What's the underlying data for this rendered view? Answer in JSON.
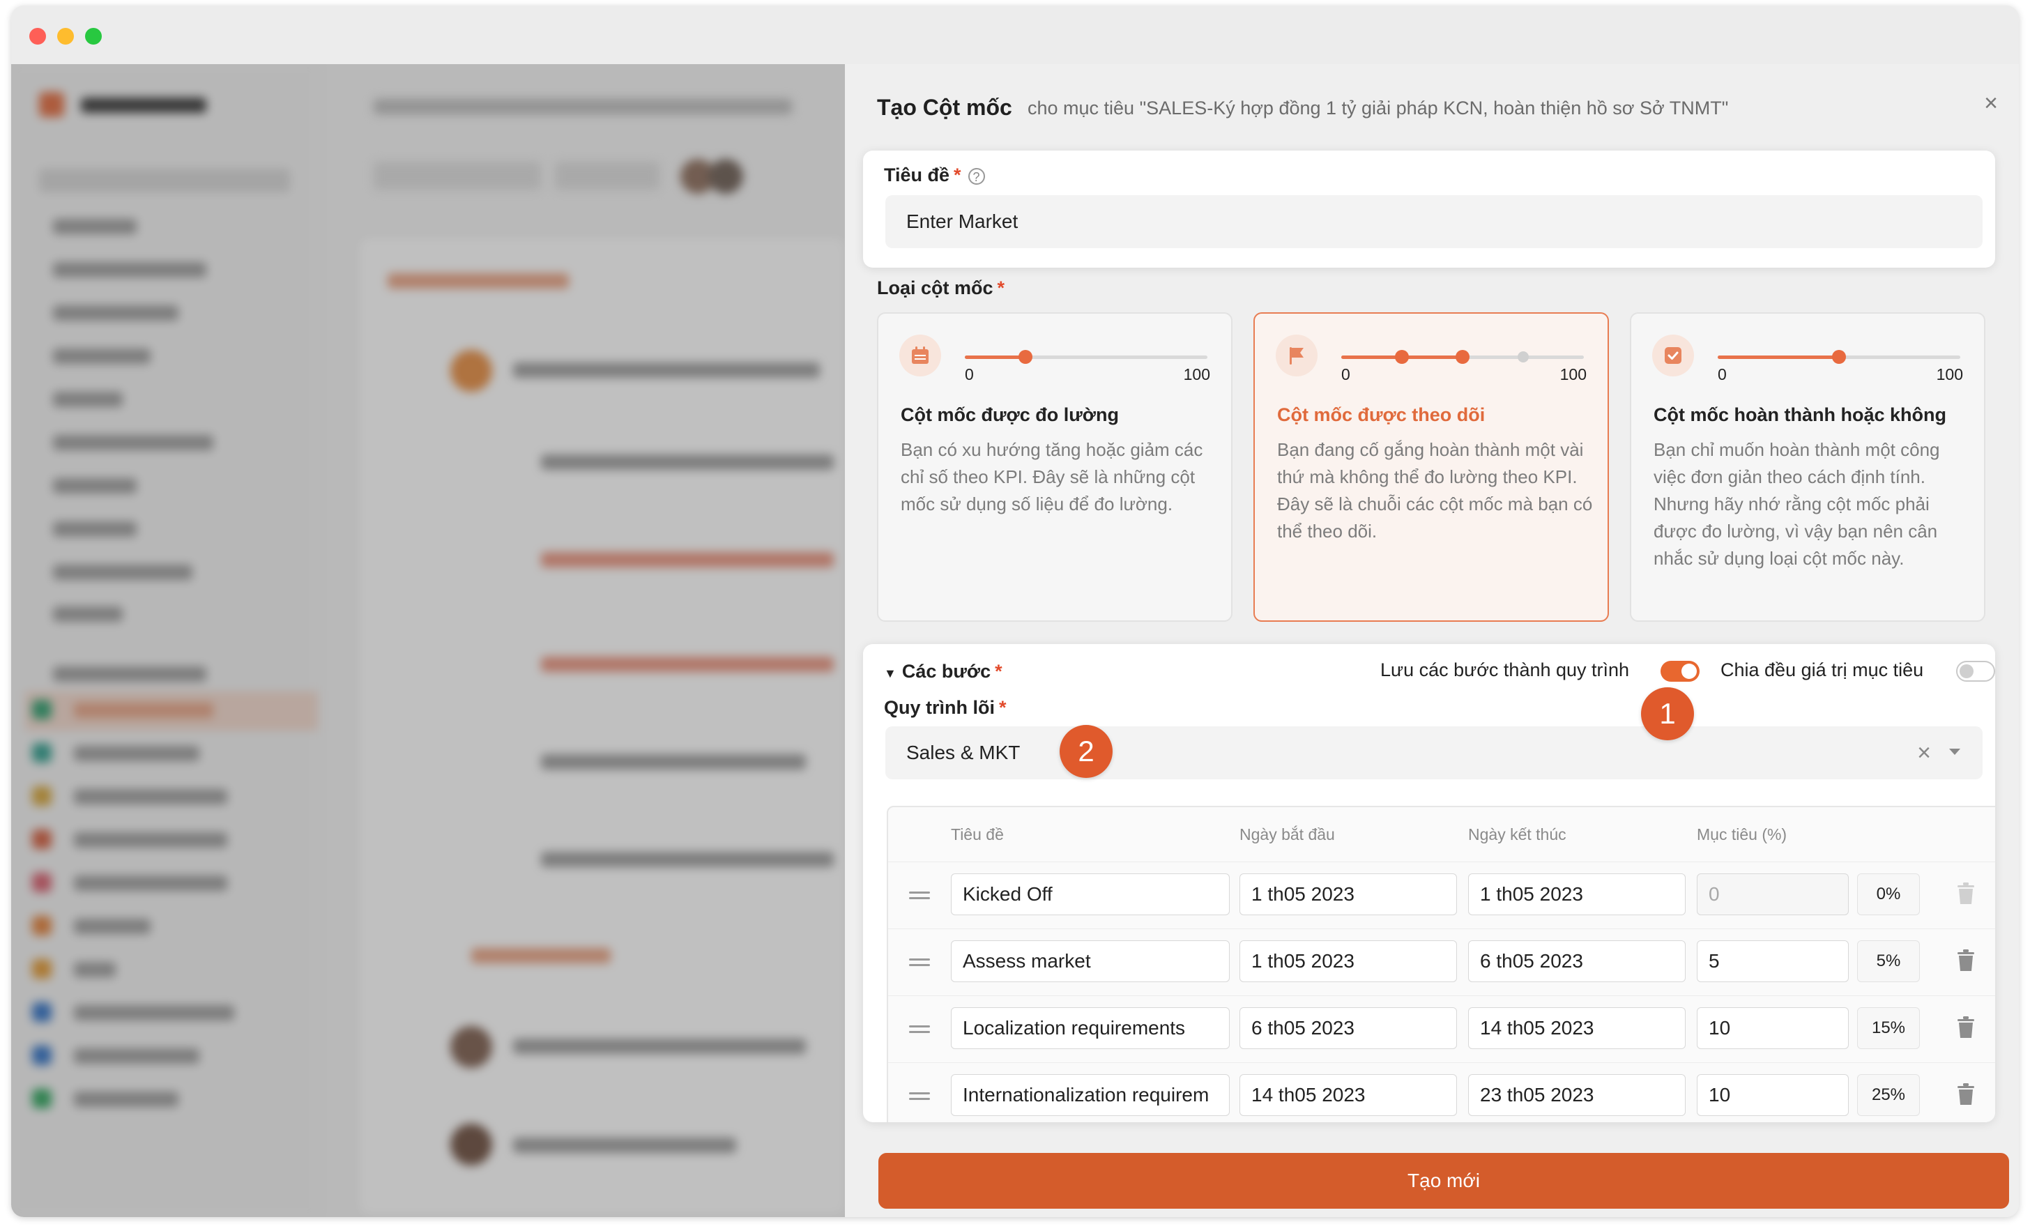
{
  "drawer": {
    "title": "Tạo Cột mốc",
    "subtitle": "cho mục tiêu \"SALES-Ký hợp đồng 1 tỷ giải pháp KCN, hoàn thiện hồ sơ Sở TNMT\"",
    "close_glyph": "×"
  },
  "title_field": {
    "label": "Tiêu đề",
    "required": "*",
    "help_glyph": "?",
    "value": "Enter Market"
  },
  "milestone_type": {
    "label": "Loại cột mốc",
    "required": "*",
    "options": [
      {
        "name": "Cột mốc được đo lường",
        "description": "Bạn có xu hướng tăng hoặc giảm các chỉ số theo KPI. Đây sẽ là những cột mốc sử dụng số liệu để đo lường.",
        "min": "0",
        "max": "100",
        "selected": false,
        "icon": "calendar-icon",
        "slider_value_pct": 25
      },
      {
        "name": "Cột mốc được theo dõi",
        "description": "Bạn đang cố gắng hoàn thành một vài thứ mà không thể đo lường theo KPI. Đây sẽ là chuỗi các cột mốc mà bạn có thể theo dõi.",
        "min": "0",
        "max": "100",
        "selected": true,
        "icon": "flag-icon",
        "slider_points_pct": [
          25,
          50,
          75
        ]
      },
      {
        "name": "Cột mốc hoàn thành hoặc không",
        "description": "Bạn chỉ muốn hoàn thành một công việc đơn giản theo cách định tính. Nhưng hãy nhớ rằng cột mốc phải được đo lường, vì vậy bạn nên cân nhắc sử dụng loại cột mốc này.",
        "min": "0",
        "max": "100",
        "selected": false,
        "icon": "checkbox-icon",
        "slider_value_pct": 50
      }
    ]
  },
  "steps": {
    "label": "Các bước",
    "required": "*",
    "save_as_process_label": "Lưu các bước thành quy trình",
    "save_as_process_on": true,
    "split_target_label": "Chia đều giá trị mục tiêu",
    "split_target_on": false,
    "core_process_label": "Quy trình lõi",
    "core_process_value": "Sales & MKT",
    "clear_glyph": "×",
    "columns": [
      "Tiêu đề",
      "Ngày bắt đầu",
      "Ngày kết thúc",
      "Mục tiêu (%)"
    ],
    "rows": [
      {
        "title": "Kicked Off",
        "start": "1 th05 2023",
        "end": "1 th05 2023",
        "target": "0",
        "cumulative": "0%",
        "target_readonly": true
      },
      {
        "title": "Assess market",
        "start": "1 th05 2023",
        "end": "6 th05 2023",
        "target": "5",
        "cumulative": "5%",
        "target_readonly": false
      },
      {
        "title": "Localization requirements",
        "start": "6 th05 2023",
        "end": "14 th05 2023",
        "target": "10",
        "cumulative": "15%",
        "target_readonly": false
      },
      {
        "title": "Internationalization requirem",
        "start": "14 th05 2023",
        "end": "23 th05 2023",
        "target": "10",
        "cumulative": "25%",
        "target_readonly": false
      }
    ]
  },
  "annotations": {
    "badge_1": "1",
    "badge_2": "2"
  },
  "footer": {
    "create_label": "Tạo mới"
  },
  "colors": {
    "accent": "#e8672f",
    "button": "#d45c2b",
    "badge": "#e05a2c"
  }
}
